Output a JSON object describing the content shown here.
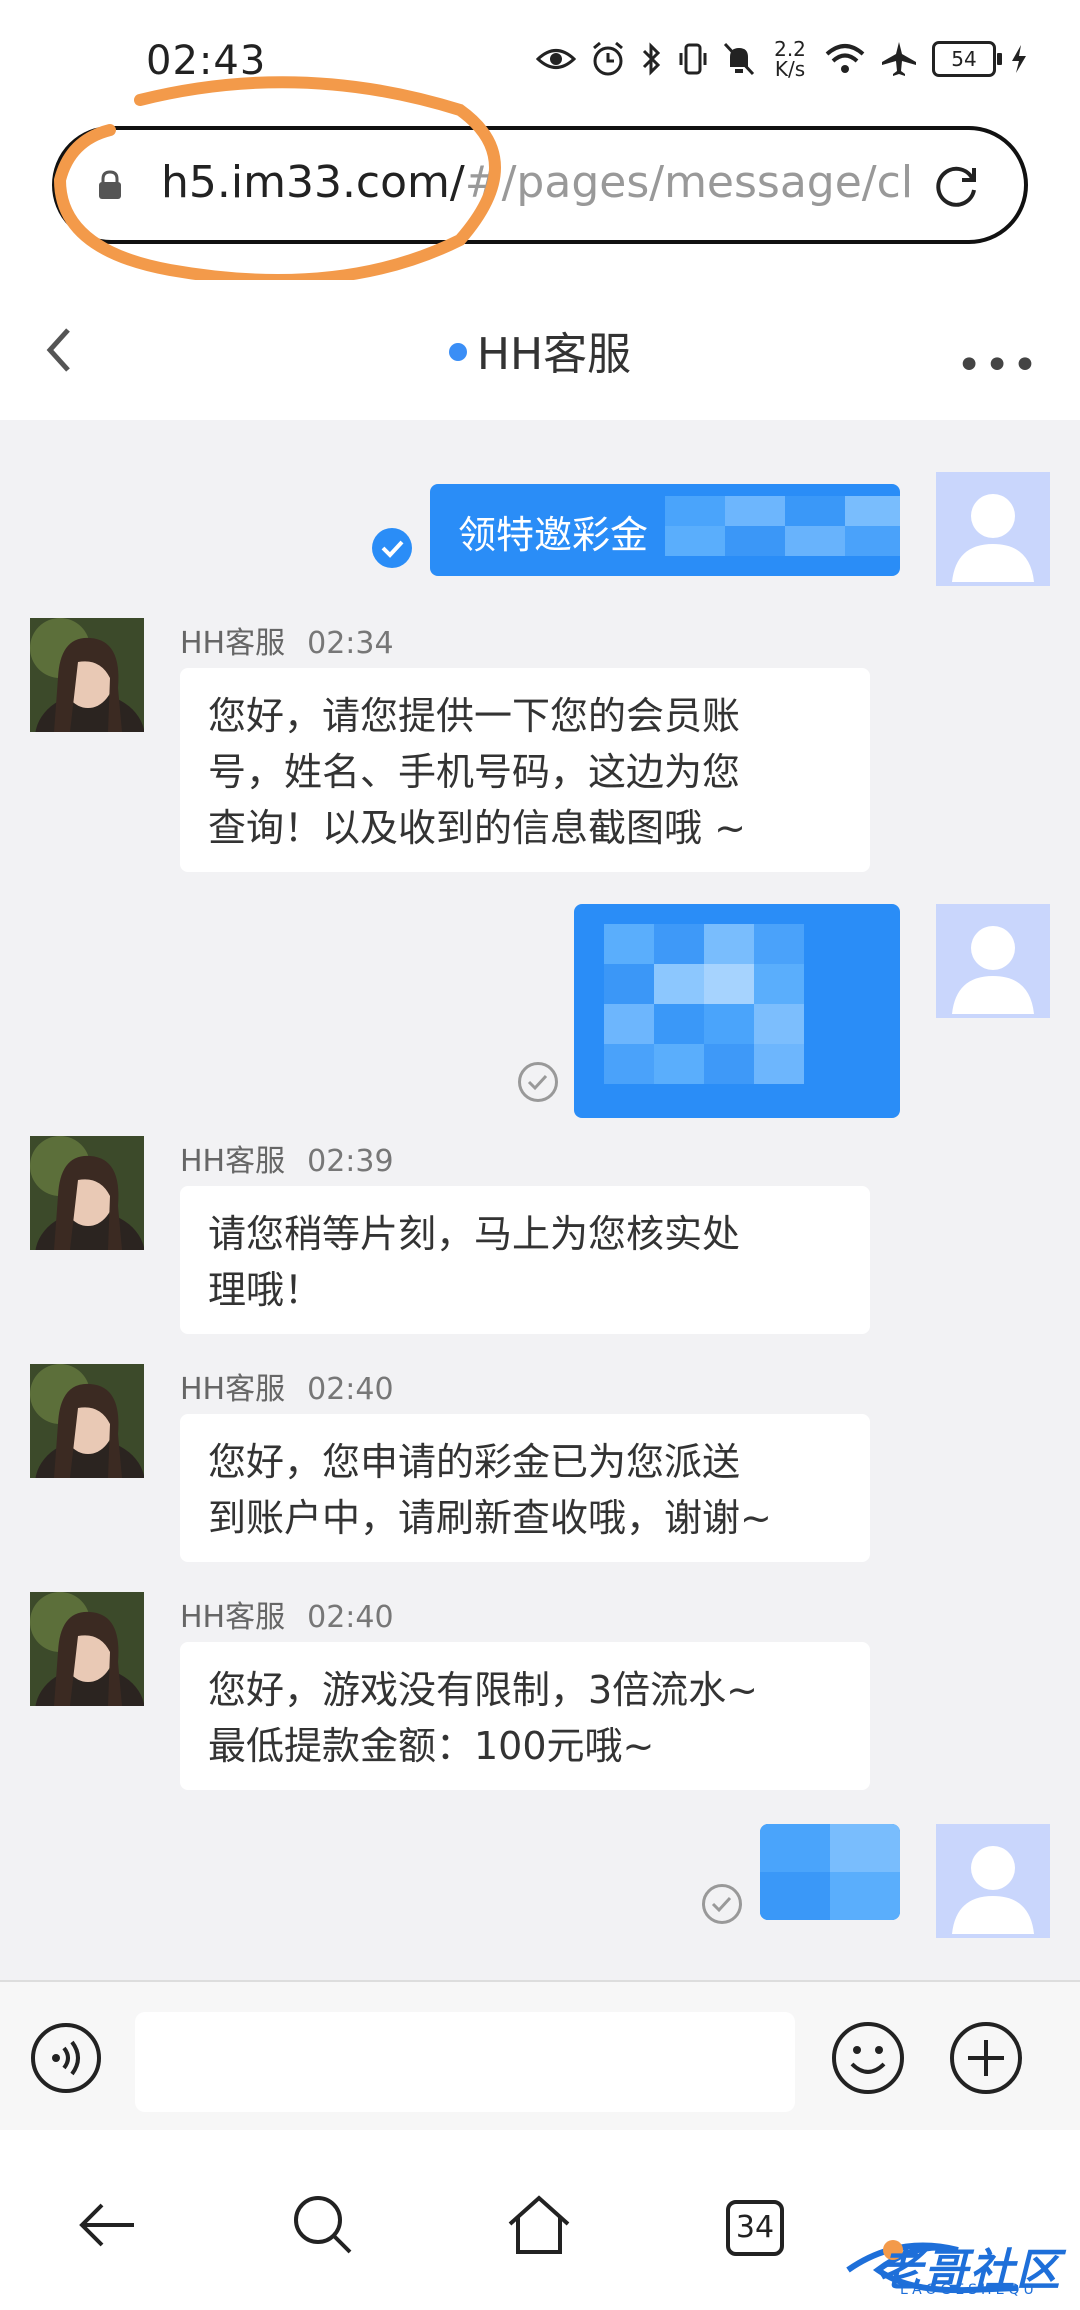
{
  "status_bar": {
    "time": "02:43",
    "net_speed_value": "2.2",
    "net_speed_unit": "K/s",
    "battery": "54",
    "icons": [
      "eye-icon",
      "alarm-icon",
      "bluetooth-icon",
      "vibrate-icon",
      "mute-icon",
      "wifi-icon",
      "airplane-icon",
      "battery-icon",
      "charging-icon"
    ]
  },
  "browser": {
    "url_main": "h5.im33.com/",
    "url_rest": "#/pages/message/cl"
  },
  "chat": {
    "title": "HH客服",
    "more_label": "•••",
    "sent_first_text": "领特邀彩金",
    "messages": [
      {
        "sender": "HH客服",
        "time": "02:34",
        "text_lines": [
          "您好，请您提供一下您的会员账",
          "号，姓名、手机号码，这边为您",
          "查询！以及收到的信息截图哦 ~"
        ]
      },
      {
        "sender": "HH客服",
        "time": "02:39",
        "text_lines": [
          "请您稍等片刻，马上为您核实处",
          "理哦！"
        ]
      },
      {
        "sender": "HH客服",
        "time": "02:40",
        "text_lines": [
          "您好，您申请的彩金已为您派送",
          "到账户中，请刷新查收哦，谢谢~"
        ]
      },
      {
        "sender": "HH客服",
        "time": "02:40",
        "text_lines": [
          "您好，游戏没有限制，3倍流水~",
          "最低提款金额：100元哦~"
        ]
      }
    ]
  },
  "input": {
    "placeholder": ""
  },
  "nav": {
    "tabs_count": "34"
  },
  "watermark": {
    "text": "老哥社区",
    "sub": "LAOGESHEQU"
  },
  "colors": {
    "accent": "#2a8df7",
    "bg": "#f2f2f4",
    "annotation": "#f39a4a"
  }
}
